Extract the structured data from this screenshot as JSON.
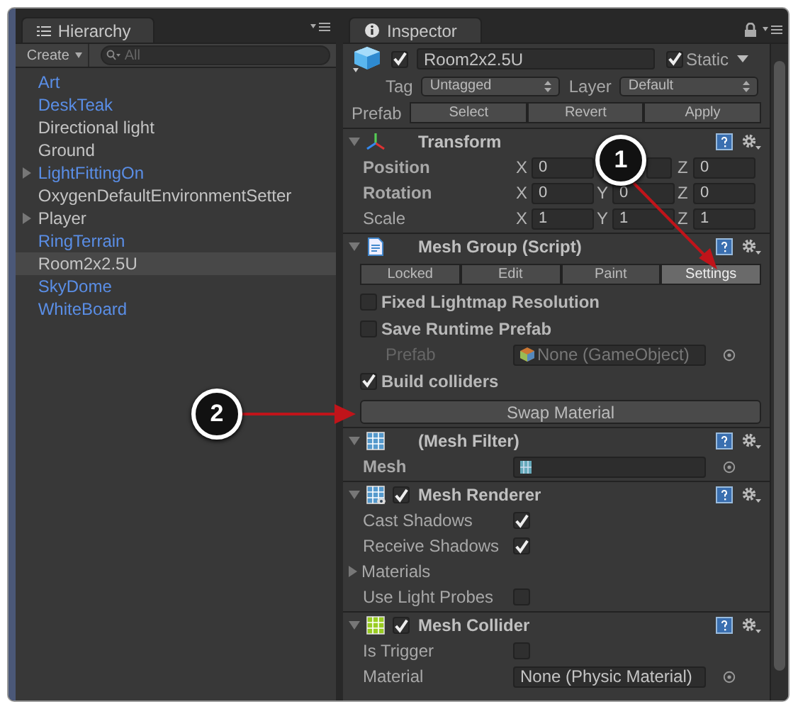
{
  "hierarchy": {
    "title": "Hierarchy",
    "create_button": "Create",
    "search": {
      "placeholder": "All"
    },
    "items": [
      {
        "label": "Art",
        "kind": "prefab",
        "expandable": false,
        "selected": false
      },
      {
        "label": "DeskTeak",
        "kind": "prefab",
        "expandable": false,
        "selected": false
      },
      {
        "label": "Directional light",
        "kind": "object",
        "expandable": false,
        "selected": false
      },
      {
        "label": "Ground",
        "kind": "object",
        "expandable": false,
        "selected": false
      },
      {
        "label": "LightFittingOn",
        "kind": "prefab",
        "expandable": true,
        "selected": false
      },
      {
        "label": "OxygenDefaultEnvironmentSetter",
        "kind": "object",
        "expandable": false,
        "selected": false
      },
      {
        "label": "Player",
        "kind": "object",
        "expandable": true,
        "selected": false
      },
      {
        "label": "RingTerrain",
        "kind": "prefab",
        "expandable": false,
        "selected": false
      },
      {
        "label": "Room2x2.5U",
        "kind": "object",
        "expandable": false,
        "selected": true
      },
      {
        "label": "SkyDome",
        "kind": "prefab",
        "expandable": false,
        "selected": false
      },
      {
        "label": "WhiteBoard",
        "kind": "prefab",
        "expandable": false,
        "selected": false
      }
    ]
  },
  "inspector": {
    "title": "Inspector",
    "object": {
      "enabled": true,
      "name": "Room2x2.5U",
      "static": true,
      "static_label": "Static"
    },
    "tag": {
      "label": "Tag",
      "value": "Untagged"
    },
    "layer": {
      "label": "Layer",
      "value": "Default"
    },
    "prefab": {
      "label": "Prefab",
      "buttons": [
        "Select",
        "Revert",
        "Apply"
      ]
    },
    "components": [
      {
        "name": "Transform",
        "kind": "transform",
        "rows": [
          {
            "kind": "vector",
            "label": "Position",
            "bold": true,
            "fields": [
              {
                "kind": "number",
                "axis": "X",
                "value": "0"
              },
              {
                "kind": "covered"
              },
              {
                "kind": "number",
                "axis": "Z",
                "value": "0"
              }
            ]
          },
          {
            "kind": "vector",
            "label": "Rotation",
            "bold": true,
            "fields": [
              {
                "kind": "number",
                "axis": "X",
                "value": "0"
              },
              {
                "kind": "number",
                "axis": "Y",
                "value": "0"
              },
              {
                "kind": "number",
                "axis": "Z",
                "value": "0"
              }
            ]
          },
          {
            "kind": "vector",
            "label": "Scale",
            "bold": false,
            "fields": [
              {
                "kind": "number",
                "axis": "X",
                "value": "1"
              },
              {
                "kind": "number",
                "axis": "Y",
                "value": "1"
              },
              {
                "kind": "number",
                "axis": "Z",
                "value": "1"
              }
            ]
          }
        ]
      },
      {
        "name": "Mesh Group (Script)",
        "kind": "script",
        "rows": [
          {
            "kind": "toolbar",
            "buttons": [
              {
                "label": "Locked",
                "selected": false
              },
              {
                "label": "Edit",
                "selected": false
              },
              {
                "label": "Paint",
                "selected": false
              },
              {
                "label": "Settings",
                "selected": true
              }
            ]
          },
          {
            "kind": "toggle_left",
            "label": "Fixed Lightmap Resolution",
            "checked": false
          },
          {
            "kind": "toggle_left",
            "label": "Save Runtime Prefab",
            "checked": false
          },
          {
            "kind": "gameobject_field",
            "label": "Prefab",
            "disabled": true,
            "value": "None (GameObject)"
          },
          {
            "kind": "toggle_left",
            "label": "Build colliders",
            "checked": true
          },
          {
            "kind": "button",
            "label": "Swap Material"
          }
        ]
      },
      {
        "name": "(Mesh Filter)",
        "kind": "mesh_filter",
        "rows": [
          {
            "kind": "mesh_field",
            "label": "Mesh",
            "bold": true
          }
        ]
      },
      {
        "name": "Mesh Renderer",
        "kind": "mesh_renderer",
        "enabled": true,
        "rows": [
          {
            "kind": "toggle",
            "label": "Cast Shadows",
            "checked": true
          },
          {
            "kind": "toggle",
            "label": "Receive Shadows",
            "checked": true
          },
          {
            "kind": "foldout",
            "label": "Materials"
          },
          {
            "kind": "toggle",
            "label": "Use Light Probes",
            "checked": false
          }
        ]
      },
      {
        "name": "Mesh Collider",
        "kind": "mesh_collider",
        "enabled": true,
        "rows": [
          {
            "kind": "toggle",
            "label": "Is Trigger",
            "checked": false
          },
          {
            "kind": "object",
            "label": "Material",
            "value": "None (Physic Material)"
          }
        ]
      }
    ]
  },
  "callouts": [
    {
      "label": "1"
    },
    {
      "label": "2"
    }
  ]
}
